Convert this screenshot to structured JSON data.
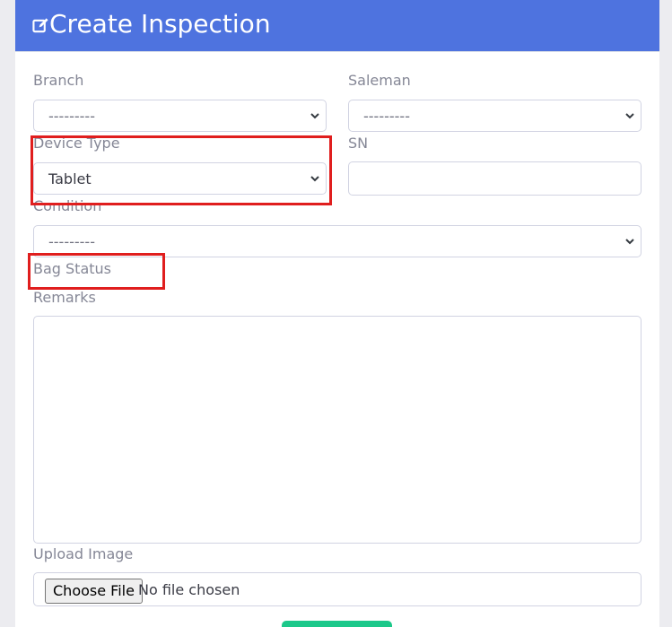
{
  "header": {
    "title": "Create Inspection",
    "icon": "edit-icon",
    "color": "#4e73df"
  },
  "form": {
    "branch": {
      "label": "Branch",
      "value": "---------"
    },
    "saleman": {
      "label": "Saleman",
      "value": "---------"
    },
    "device_type": {
      "label": "Device Type",
      "value": "Tablet"
    },
    "sn": {
      "label": "SN",
      "value": ""
    },
    "condition": {
      "label": "Condition",
      "value": "---------"
    },
    "bag_status": {
      "label": "Bag Status"
    },
    "remarks": {
      "label": "Remarks",
      "value": ""
    },
    "upload_image": {
      "label": "Upload Image",
      "button_label": "Choose File",
      "status": "No file chosen"
    },
    "submit": {
      "color": "#1cc88a"
    }
  },
  "annotations": {
    "color": "#e01e1e"
  }
}
